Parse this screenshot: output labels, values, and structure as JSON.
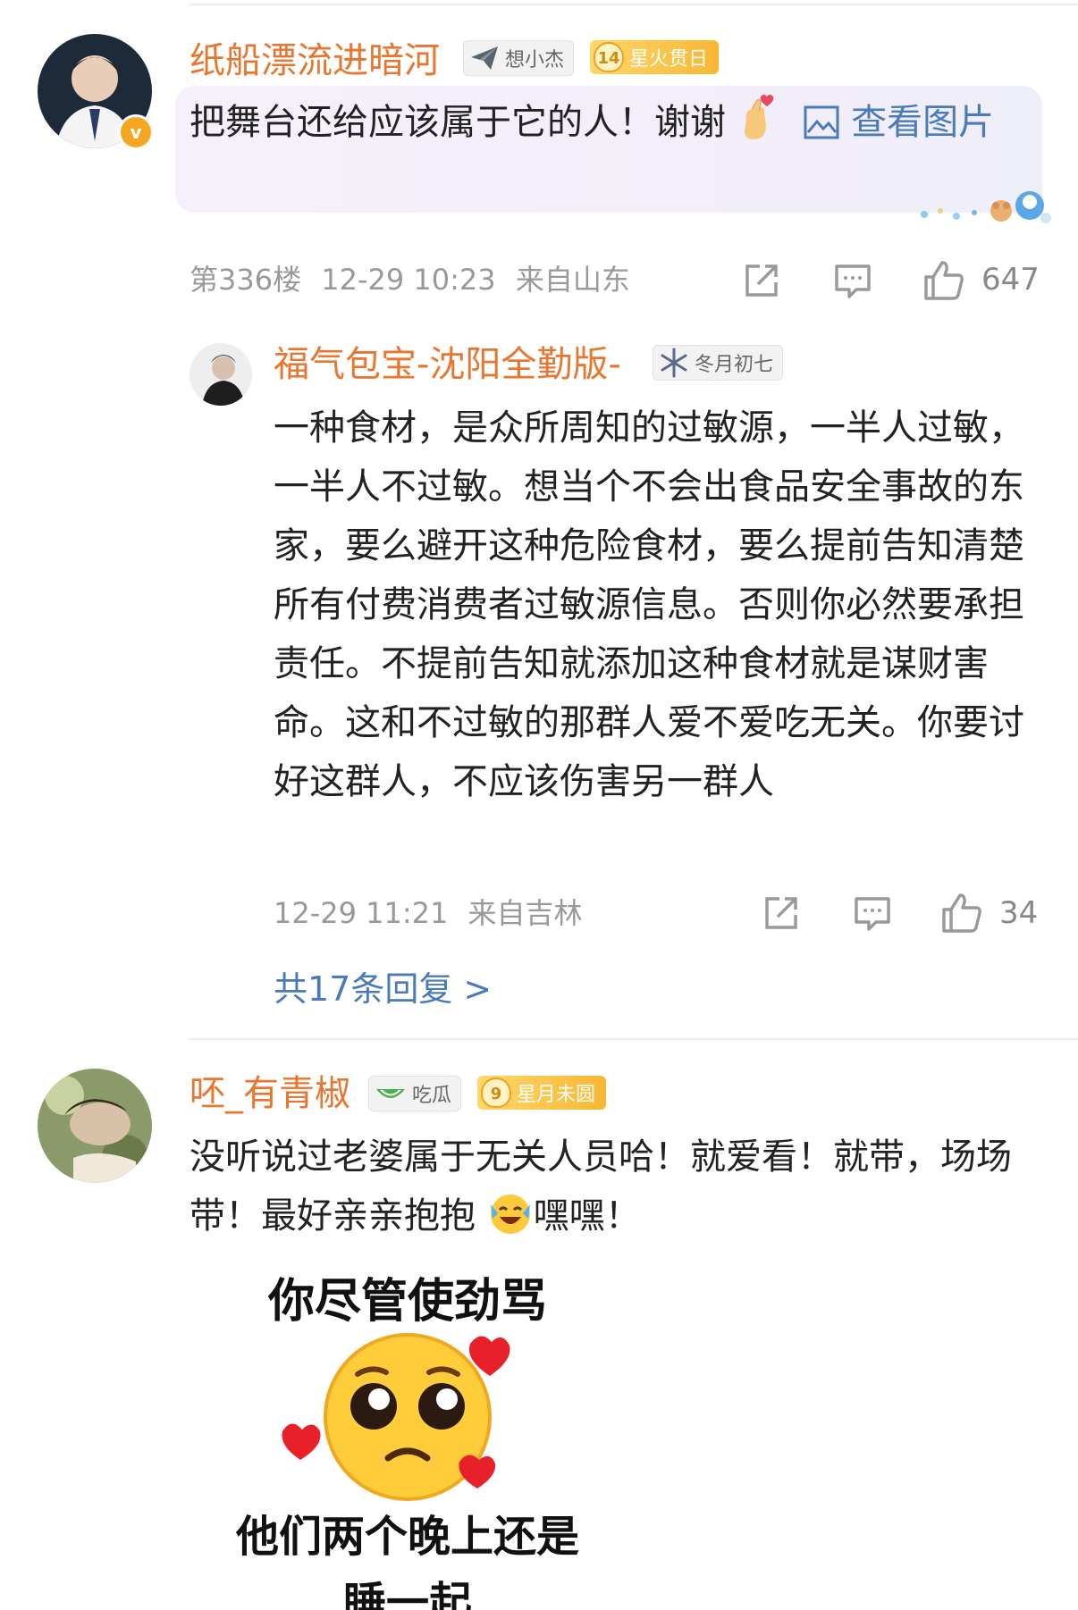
{
  "comments": [
    {
      "username": "纸船漂流进暗河",
      "badges": [
        "想小杰",
        "14",
        "星火贯日"
      ],
      "text": "把舞台还给应该属于它的人！谢谢",
      "view_image_label": "查看图片",
      "floor": "第336楼",
      "time": "12-29 10:23",
      "location": "来自山东",
      "likes": "647"
    },
    {
      "username": "福气包宝-沈阳全勤版-",
      "badges": [
        "冬月初七"
      ],
      "text": "一种食材，是众所周知的过敏源，一半人过敏，一半人不过敏。想当个不会出食品安全事故的东家，要么避开这种危险食材，要么提前告知清楚所有付费消费者过敏源信息。否则你必然要承担责任。不提前告知就添加这种食材就是谋财害命。这和不过敏的那群人爱不爱吃无关。你要讨好这群人，不应该伤害另一群人",
      "time": "12-29 11:21",
      "location": "来自吉林",
      "likes": "34",
      "replies_label": "共17条回复 >"
    },
    {
      "username": "呸_有青椒",
      "badges": [
        "吃瓜",
        "9",
        "星月未圆"
      ],
      "text": "没听说过老婆属于无关人员哈！就爱看！就带，场场带！最好亲亲抱抱",
      "text_suffix": "嘿嘿！",
      "meme_top": "你尽管使劲骂",
      "meme_bottom": "他们两个晚上还是",
      "meme_cut": "睡一起"
    }
  ],
  "colors": {
    "username": "#e8762f",
    "link": "#4a7bb8",
    "meta": "#999999",
    "verified": "#f5a623",
    "badge_gold": "#f7b733"
  },
  "icons": [
    "verified-icon",
    "paper-plane-icon",
    "snowflake-icon",
    "watermelon-icon",
    "image-icon",
    "share-icon",
    "comment-icon",
    "thumbs-up-icon",
    "fingers-heart-emoji",
    "cry-laugh-emoji",
    "pleading-face-emoji"
  ]
}
